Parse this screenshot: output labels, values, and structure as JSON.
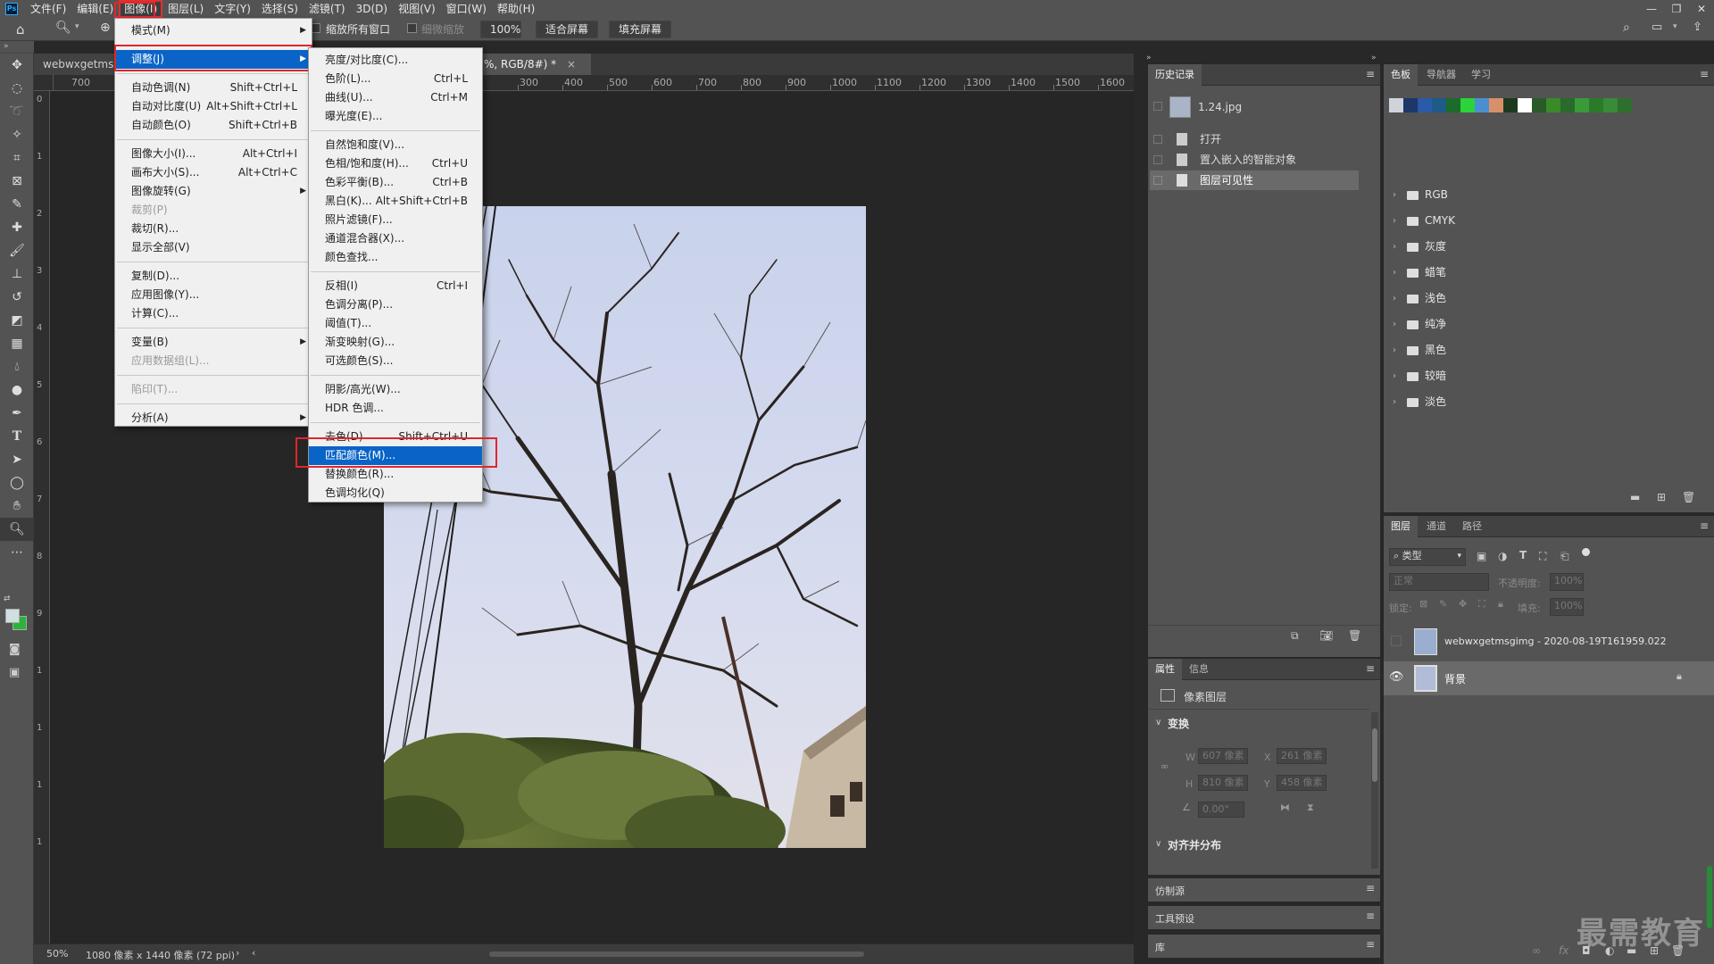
{
  "menubar": {
    "logo": "Ps",
    "items": [
      "文件(F)",
      "编辑(E)",
      "图像(I)",
      "图层(L)",
      "文字(Y)",
      "选择(S)",
      "滤镜(T)",
      "3D(D)",
      "视图(V)",
      "窗口(W)",
      "帮助(H)"
    ],
    "active_index": 2
  },
  "window_controls": [
    "—",
    "❐",
    "✕"
  ],
  "options_bar": {
    "resize_all_windows": "缩放所有窗口",
    "scrubby_zoom": "细微缩放",
    "zoom_value": "100%",
    "fit_screen": "适合屏幕",
    "fill_screen": "填充屏幕"
  },
  "document": {
    "tab_left": "webwxgetmsg",
    "tab_right": "%, RGB/8#) *",
    "tab_close": "×"
  },
  "ruler": {
    "h_labels_left": [
      "700"
    ],
    "h_labels": [
      "300",
      "400",
      "500",
      "600",
      "700",
      "800",
      "900",
      "1000",
      "1100",
      "1200",
      "1300",
      "1400",
      "1500",
      "1600"
    ],
    "v_labels": [
      "0",
      "1",
      "2",
      "3",
      "4",
      "5",
      "6",
      "7",
      "8",
      "9",
      "1",
      "1",
      "1",
      "1"
    ]
  },
  "status": {
    "zoom": "50%",
    "doc_info": "1080 像素 x 1440 像素 (72 ppi)",
    "arrow": "›",
    "arrow_left": "‹"
  },
  "image_menu": {
    "items": [
      {
        "label": "模式(M)",
        "submenu": true
      },
      {
        "sep": true
      },
      {
        "label": "调整(J)",
        "submenu": true,
        "highlighted": true
      },
      {
        "sep": true
      },
      {
        "label": "自动色调(N)",
        "shortcut": "Shift+Ctrl+L"
      },
      {
        "label": "自动对比度(U)",
        "shortcut": "Alt+Shift+Ctrl+L"
      },
      {
        "label": "自动颜色(O)",
        "shortcut": "Shift+Ctrl+B"
      },
      {
        "sep": true
      },
      {
        "label": "图像大小(I)...",
        "shortcut": "Alt+Ctrl+I"
      },
      {
        "label": "画布大小(S)...",
        "shortcut": "Alt+Ctrl+C"
      },
      {
        "label": "图像旋转(G)",
        "submenu": true
      },
      {
        "label": "裁剪(P)",
        "disabled": true
      },
      {
        "label": "裁切(R)..."
      },
      {
        "label": "显示全部(V)"
      },
      {
        "sep": true
      },
      {
        "label": "复制(D)..."
      },
      {
        "label": "应用图像(Y)..."
      },
      {
        "label": "计算(C)..."
      },
      {
        "sep": true
      },
      {
        "label": "变量(B)",
        "submenu": true
      },
      {
        "label": "应用数据组(L)...",
        "disabled": true
      },
      {
        "sep": true
      },
      {
        "label": "陷印(T)...",
        "disabled": true
      },
      {
        "sep": true
      },
      {
        "label": "分析(A)",
        "submenu": true
      }
    ]
  },
  "adjust_menu": {
    "items": [
      {
        "label": "亮度/对比度(C)..."
      },
      {
        "label": "色阶(L)...",
        "shortcut": "Ctrl+L"
      },
      {
        "label": "曲线(U)...",
        "shortcut": "Ctrl+M"
      },
      {
        "label": "曝光度(E)..."
      },
      {
        "sep": true
      },
      {
        "label": "自然饱和度(V)..."
      },
      {
        "label": "色相/饱和度(H)...",
        "shortcut": "Ctrl+U"
      },
      {
        "label": "色彩平衡(B)...",
        "shortcut": "Ctrl+B"
      },
      {
        "label": "黑白(K)...",
        "shortcut": "Alt+Shift+Ctrl+B"
      },
      {
        "label": "照片滤镜(F)..."
      },
      {
        "label": "通道混合器(X)..."
      },
      {
        "label": "颜色查找..."
      },
      {
        "sep": true
      },
      {
        "label": "反相(I)",
        "shortcut": "Ctrl+I"
      },
      {
        "label": "色调分离(P)..."
      },
      {
        "label": "阈值(T)..."
      },
      {
        "label": "渐变映射(G)..."
      },
      {
        "label": "可选颜色(S)..."
      },
      {
        "sep": true
      },
      {
        "label": "阴影/高光(W)..."
      },
      {
        "label": "HDR 色调..."
      },
      {
        "sep": true
      },
      {
        "label": "去色(D)",
        "shortcut": "Shift+Ctrl+U"
      },
      {
        "label": "匹配颜色(M)...",
        "highlighted": true
      },
      {
        "label": "替换颜色(R)..."
      },
      {
        "label": "色调均化(Q)"
      }
    ]
  },
  "history_panel": {
    "tab": "历史记录",
    "snapshot": "1.24.jpg",
    "steps": [
      "打开",
      "置入嵌入的智能对象",
      "图层可见性"
    ]
  },
  "swatches_panel": {
    "tabs": [
      "色板",
      "导航器",
      "学习"
    ],
    "colors": [
      "#cfd4da",
      "#1c3768",
      "#2a5aa8",
      "#1e5a8a",
      "#1e6a2a",
      "#2ad43a",
      "#4a90d0",
      "#d8906a",
      "#1e3a1e",
      "#ffffff",
      "#2a5a2a",
      "#3a8a2a",
      "#2a6a2a",
      "#3a9a3a",
      "#2a7a2a",
      "#3a8a3a",
      "#2e6e2e"
    ],
    "groups": [
      "RGB",
      "CMYK",
      "灰度",
      "蜡笔",
      "浅色",
      "纯净",
      "黑色",
      "较暗",
      "淡色"
    ]
  },
  "layers_panel": {
    "tabs": [
      "图层",
      "通道",
      "路径"
    ],
    "filter_kind": "类型",
    "blend_mode": "正常",
    "opacity_label": "不透明度:",
    "opacity_value": "100%",
    "lock_label": "锁定:",
    "fill_label": "填充:",
    "fill_value": "100%",
    "layers": [
      {
        "name": "webwxgetmsgimg - 2020-08-19T161959.022",
        "visible": false
      },
      {
        "name": "背景",
        "visible": true,
        "locked": true,
        "selected": true
      }
    ]
  },
  "properties_panel": {
    "tabs": [
      "属性",
      "信息"
    ],
    "layer_type": "像素图层",
    "transform_title": "变换",
    "w_label": "W",
    "w_value": "607 像素",
    "h_label": "H",
    "h_value": "810 像素",
    "x_label": "X",
    "x_value": "261 像素",
    "y_label": "Y",
    "y_value": "458 像素",
    "angle_value": "0.00°",
    "align_title": "对齐并分布"
  },
  "collapsed_panels": [
    "仿制源",
    "工具预设",
    "库"
  ],
  "watermark": "最需教育",
  "colors": {
    "menu_highlight": "#0a64c8",
    "red_box": "#e0262b",
    "panel_bg": "#535353",
    "fg_color": "#d0dfe0",
    "bg_color": "#2ab43a"
  }
}
